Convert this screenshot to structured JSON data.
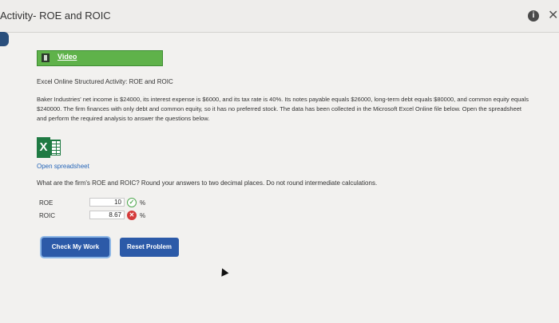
{
  "window": {
    "title": "Activity- ROE and ROIC"
  },
  "video": {
    "label": "Video"
  },
  "activity": {
    "heading": "Excel Online Structured Activity: ROE and ROIC",
    "paragraph": "Baker Industries' net income is $24000, its interest expense is $6000, and its tax rate is 40%. Its notes payable equals $26000, long-term debt equals $80000, and common equity equals $240000. The firm finances with only debt and common equity, so it has no preferred stock. The data has been collected in the Microsoft Excel Online file below. Open the spreadsheet and perform the required analysis to answer the questions below.",
    "open_link": "Open spreadsheet",
    "question": "What are the firm's ROE and ROIC? Round your answers to two decimal places. Do not round intermediate calculations."
  },
  "answers": [
    {
      "label": "ROE",
      "value": "10",
      "unit": "%",
      "status": "correct"
    },
    {
      "label": "ROIC",
      "value": "8.67",
      "unit": "%",
      "status": "incorrect"
    }
  ],
  "buttons": {
    "check": "Check My Work",
    "reset": "Reset Problem"
  },
  "icons": {
    "info": "info-icon",
    "close": "close-icon",
    "video": "video-icon",
    "excel": "excel-icon"
  },
  "colors": {
    "video_bar": "#5fb24a",
    "button": "#2c5aa8",
    "link": "#2766b8",
    "correct": "#4fa84f",
    "incorrect": "#d43a3a"
  }
}
